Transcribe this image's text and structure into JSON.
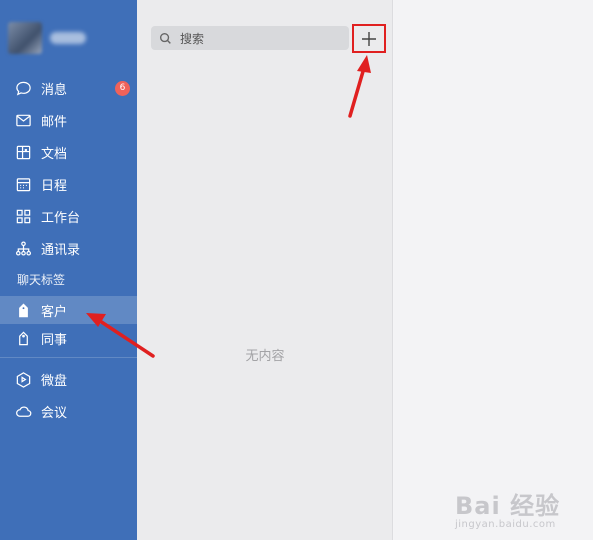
{
  "sidebar": {
    "items": [
      {
        "label": "消息",
        "icon": "chat-bubble-icon",
        "badge": "6"
      },
      {
        "label": "邮件",
        "icon": "mail-icon"
      },
      {
        "label": "文档",
        "icon": "document-icon"
      },
      {
        "label": "日程",
        "icon": "calendar-icon"
      },
      {
        "label": "工作台",
        "icon": "grid-icon"
      },
      {
        "label": "通讯录",
        "icon": "org-chart-icon"
      }
    ],
    "section_label": "聊天标签",
    "tags": [
      {
        "label": "客户",
        "icon": "tag-filled-icon",
        "active": true
      },
      {
        "label": "同事",
        "icon": "tag-outline-icon"
      }
    ],
    "bottom": [
      {
        "label": "微盘",
        "icon": "drive-icon"
      },
      {
        "label": "会议",
        "icon": "cloud-icon"
      }
    ]
  },
  "search": {
    "placeholder": "搜索"
  },
  "add_button": {
    "label": "+"
  },
  "middle": {
    "empty_text": "无内容"
  },
  "watermark": {
    "main": "Bai 经验",
    "sub": "jingyan.baidu.com"
  },
  "colors": {
    "sidebar": "#3f6fb8",
    "badge": "#f0625a",
    "highlight": "#e02020"
  }
}
